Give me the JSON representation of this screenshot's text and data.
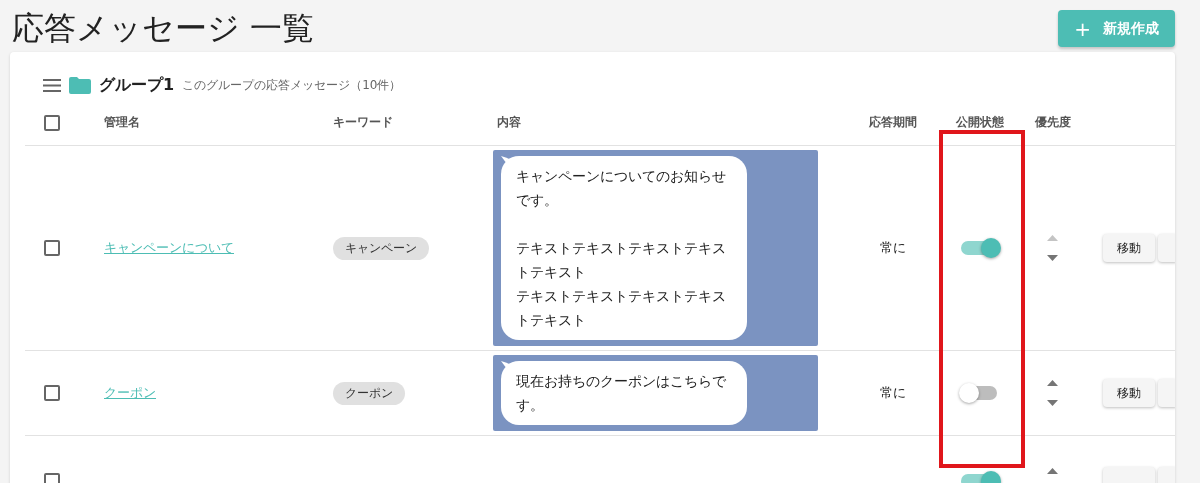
{
  "title": "応答メッセージ 一覧",
  "create_button": {
    "icon": "+",
    "label": "新規作成"
  },
  "group": {
    "name": "グループ1",
    "description": "このグループの応答メッセージ（10件）"
  },
  "table": {
    "select_all": {
      "checked": false
    },
    "columns": [
      "管理名",
      "キーワード",
      "内容",
      "応答期間",
      "公開状態",
      "優先度"
    ],
    "rows": [
      {
        "checked": false,
        "name": "キャンペーンについて",
        "keyword": "キャンペーン",
        "message": [
          [
            "キャンペーンについてのお知らせです。"
          ],
          [
            "テキストテキストテキストテキストテキスト",
            "テキストテキストテキストテキストテキスト"
          ]
        ],
        "period": "常に",
        "published": true,
        "up_disabled": true,
        "move_button": "移動"
      },
      {
        "checked": false,
        "name": "クーポン",
        "keyword": "クーポン",
        "message": [
          [
            "現在お持ちのクーポンはこちらです。"
          ]
        ],
        "period": "常に",
        "published": false,
        "up_disabled": false,
        "move_button": "移動"
      },
      {
        "checked": false,
        "published": true,
        "up_disabled": false
      }
    ]
  }
}
